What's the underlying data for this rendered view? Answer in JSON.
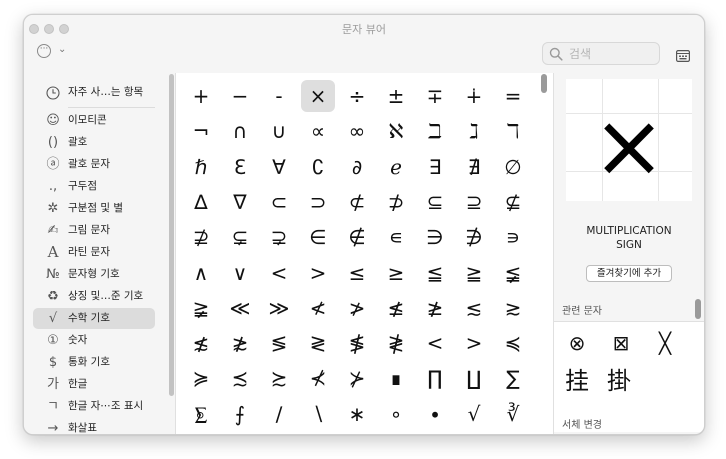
{
  "window": {
    "title": "문자 뷰어"
  },
  "toolbar": {
    "search_placeholder": "검색",
    "options_icon": "ellipsis-circle-icon",
    "layout_icon": "keyboard-layout-icon"
  },
  "sidebar": {
    "items": [
      {
        "icon": "🕘",
        "label": "자주 사…는 항목"
      },
      {
        "icon": "☺",
        "label": "이모티콘"
      },
      {
        "icon": "()",
        "label": "괄호"
      },
      {
        "icon": "ⓐ",
        "label": "괄호 문자"
      },
      {
        "icon": ".,",
        "label": "구두점"
      },
      {
        "icon": "✲",
        "label": "구분점 및 별"
      },
      {
        "icon": "✍",
        "label": "그림 문자"
      },
      {
        "icon": "A",
        "label": "라틴 문자"
      },
      {
        "icon": "№",
        "label": "문자형 기호"
      },
      {
        "icon": "♻",
        "label": "상징 및…준 기호"
      },
      {
        "icon": "√",
        "label": "수학 기호"
      },
      {
        "icon": "①",
        "label": "숫자"
      },
      {
        "icon": "$",
        "label": "통화 기호"
      },
      {
        "icon": "가",
        "label": "한글"
      },
      {
        "icon": "ㄱ",
        "label": "한글 자⋯조 표시"
      },
      {
        "icon": "→",
        "label": "화살표"
      }
    ],
    "selected_index": 10
  },
  "grid": {
    "rows": [
      [
        "+",
        "−",
        "-",
        "×",
        "÷",
        "±",
        "∓",
        "∔",
        "="
      ],
      [
        "¬",
        "∩",
        "∪",
        "∝",
        "∞",
        "ℵ",
        "ℶ",
        "ℷ",
        "ℸ"
      ],
      [
        "ℏ",
        "ℇ",
        "∀",
        "∁",
        "∂",
        "ℯ",
        "∃",
        "∄",
        "∅"
      ],
      [
        "∆",
        "∇",
        "⊂",
        "⊃",
        "⊄",
        "⊅",
        "⊆",
        "⊇",
        "⊈"
      ],
      [
        "⊉",
        "⊊",
        "⊋",
        "∈",
        "∉",
        "∊",
        "∋",
        "∌",
        "∍"
      ],
      [
        "∧",
        "∨",
        "<",
        ">",
        "≤",
        "≥",
        "≦",
        "≧",
        "≨"
      ],
      [
        "≩",
        "≪",
        "≫",
        "≮",
        "≯",
        "≰",
        "≱",
        "≲",
        "≳"
      ],
      [
        "≴",
        "≵",
        "≶",
        "≷",
        "≸",
        "≹",
        "<",
        ">",
        "≼"
      ],
      [
        "≽",
        "≾",
        "≿",
        "⊀",
        "⊁",
        "∎",
        "∏",
        "∐",
        "∑"
      ],
      [
        "⨊",
        "⨍",
        "∕",
        "∖",
        "∗",
        "∘",
        "∙",
        "√",
        "∛"
      ]
    ],
    "selected": {
      "row": 0,
      "col": 3
    }
  },
  "detail": {
    "glyph": "×",
    "name_line1": "MULTIPLICATION",
    "name_line2": "SIGN",
    "add_favorite_label": "즐겨찾기에 추가",
    "related_header": "관련 문자",
    "related": [
      "⊗",
      "⊠",
      "╳",
      "挂",
      "掛"
    ],
    "font_variation_header": "서체 변경"
  }
}
